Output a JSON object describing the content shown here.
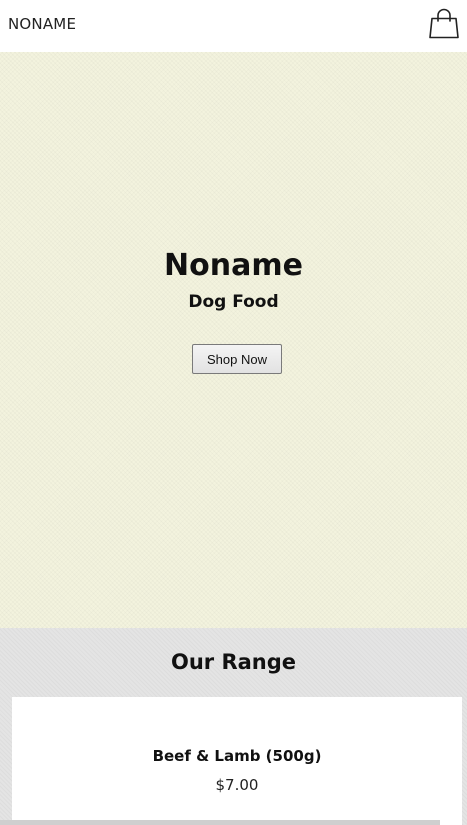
{
  "header": {
    "brand": "NONAME",
    "cart_icon": "shopping-bag-icon"
  },
  "hero": {
    "title": "Noname",
    "subtitle": "Dog Food",
    "button_label": "Shop Now",
    "background_color": "#f3f3de"
  },
  "range": {
    "title": "Our Range",
    "background_color": "#e4e4e4",
    "products": [
      {
        "name": "Beef & Lamb (500g)",
        "price": "$7.00"
      }
    ]
  }
}
